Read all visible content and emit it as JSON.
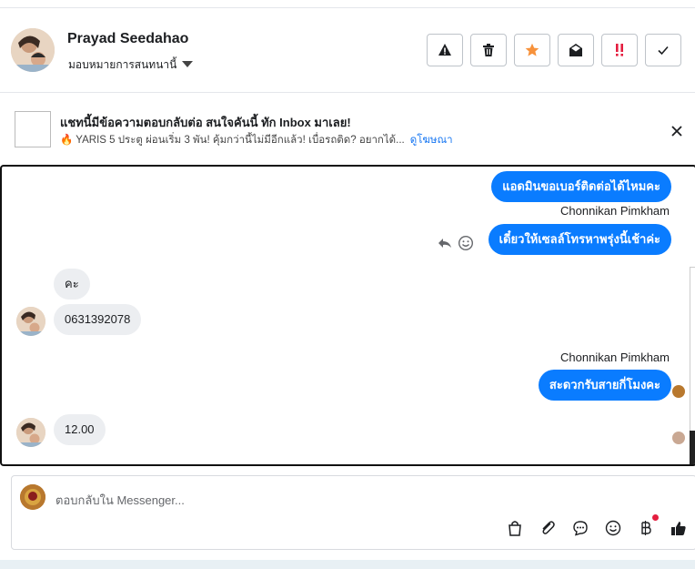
{
  "header": {
    "name": "Prayad Seedahao",
    "assign_label": "มอบหมายการสนทนานี้",
    "actions": [
      {
        "icon": "warning-icon"
      },
      {
        "icon": "trash-icon"
      },
      {
        "icon": "star-icon",
        "color": "#f7923b"
      },
      {
        "icon": "mail-open-icon"
      },
      {
        "icon": "priority-icon",
        "color": "#e41e3f"
      },
      {
        "icon": "check-icon"
      }
    ]
  },
  "ad": {
    "title": "แชทนี้มีข้อความตอบกลับต่อ สนใจคันนี้ ทัก Inbox มาเลย!",
    "subtitle": "🔥 YARIS 5 ประตู ผ่อนเริ่ม 3 พัน! คุ้มกว่านี้ไม่มีอีกแล้ว! เบื่อรถติด? อยากได้...",
    "link": "ดูโฆษณา"
  },
  "messages": {
    "m1": "แอดมินขอเบอร์ติดต่อได้ไหมคะ",
    "sender1": "Chonnikan Pimkham",
    "m2": "เดี๋ยวให้เซลล์โทรหาพรุ่งนี้เช้าค่ะ",
    "m3": "คะ",
    "m4": "0631392078",
    "sender2": "Chonnikan Pimkham",
    "m5": "สะดวกรับสายกี่โมงคะ",
    "m6": "12.00"
  },
  "composer": {
    "placeholder": "ตอบกลับใน Messenger..."
  },
  "colors": {
    "outgoing": "#0a7cff",
    "incoming": "#eceef1",
    "link": "#1877f2"
  }
}
